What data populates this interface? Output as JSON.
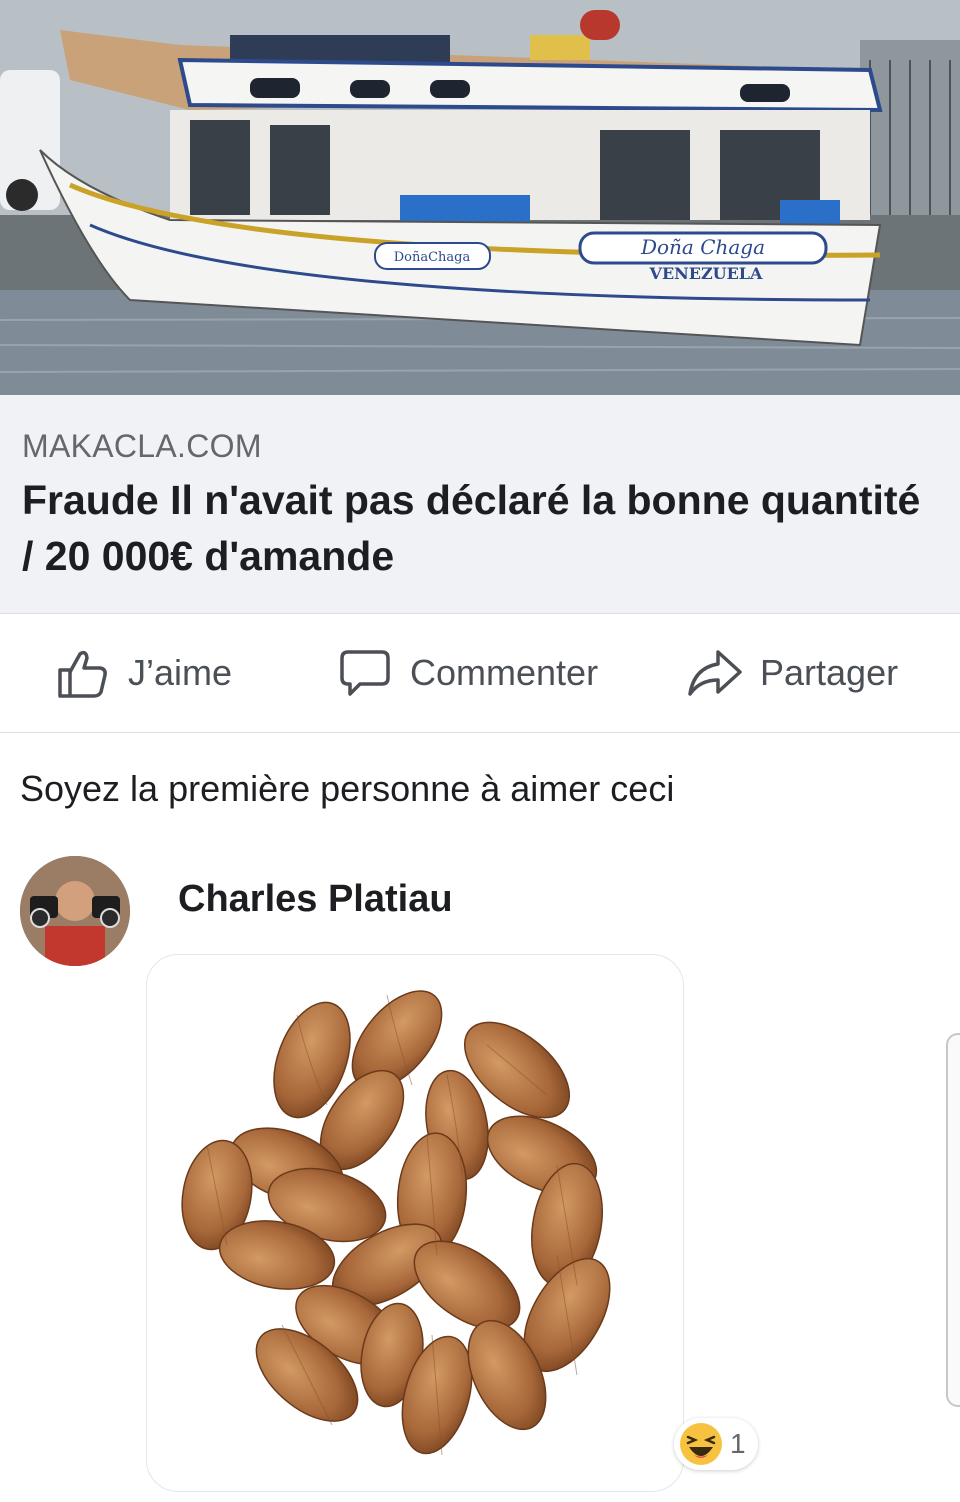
{
  "post": {
    "hero_image_alt": "fishing-boat-photo",
    "boat_name": "Doña Chaga",
    "boat_name_small": "DoñaChaga",
    "boat_country": "VENEZUELA",
    "link_domain": "MAKACLA.COM",
    "link_title": "Fraude Il n'avait pas déclaré la bonne quantité / 20 000€ d'amande"
  },
  "actions": {
    "like_label": "J’aime",
    "comment_label": "Commenter",
    "share_label": "Partager"
  },
  "likes_summary": "Soyez la première personne à aimer ceci",
  "comment": {
    "author": "Charles Platiau",
    "image_alt": "almonds-image",
    "reaction_emoji": "😆",
    "reaction_count": "1"
  },
  "colors": {
    "preview_bg": "#f0f2f5",
    "action_text": "#4b4f56",
    "muted_text": "#65676b"
  }
}
